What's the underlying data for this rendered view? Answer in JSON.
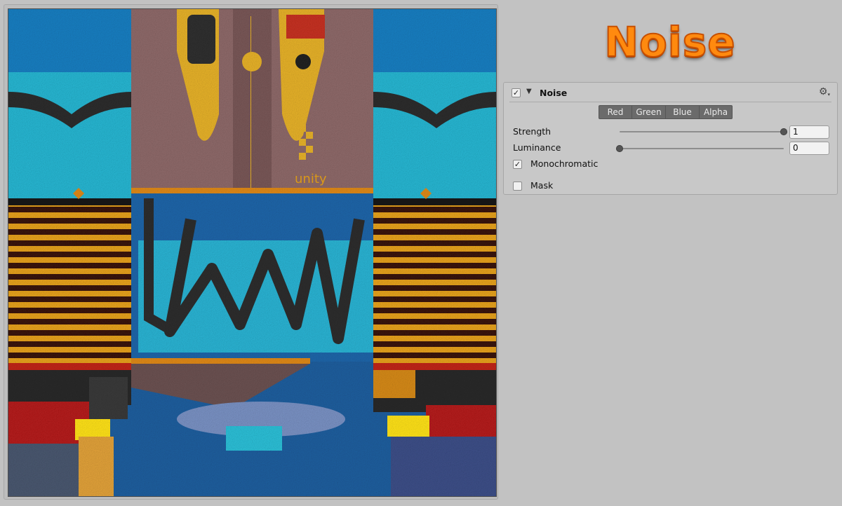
{
  "logo": {
    "text": "Noise"
  },
  "preview": {
    "watermark": "unity"
  },
  "panel": {
    "enabled": true,
    "title": "Noise",
    "enabled_mark": "✓",
    "foldout_glyph": "▼",
    "gear_glyph": "⚙",
    "gear_caret": "▾"
  },
  "channels": [
    "Red",
    "Green",
    "Blue",
    "Alpha"
  ],
  "sliders": {
    "strength": {
      "label": "Strength",
      "value": "1",
      "fraction": 1.0
    },
    "luminance": {
      "label": "Luminance",
      "value": "0",
      "fraction": 0.0
    }
  },
  "toggles": {
    "monochromatic": {
      "label": "Monochromatic",
      "checked": true,
      "mark": "✓"
    },
    "mask": {
      "label": "Mask",
      "checked": false,
      "mark": ""
    }
  },
  "colors": {
    "logo_orange": "#ff8a0f",
    "button_gray": "#6b6b6b",
    "panel_bg": "#c8c8c8"
  }
}
